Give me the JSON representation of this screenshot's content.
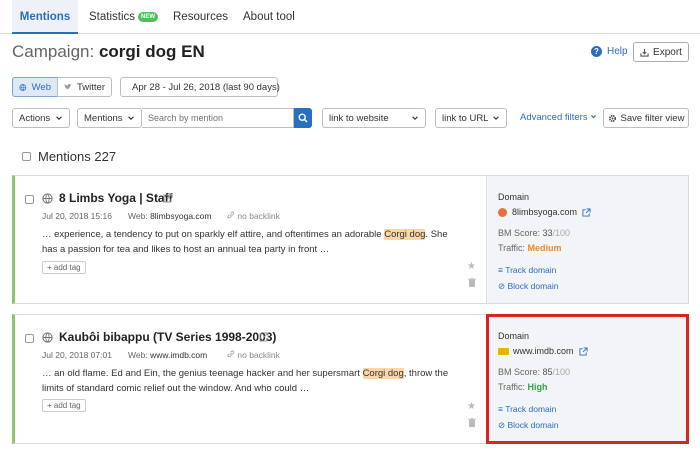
{
  "tabs": [
    {
      "label": "Mentions",
      "active": true
    },
    {
      "label": "Statistics",
      "badge": "NEW"
    },
    {
      "label": "Resources"
    },
    {
      "label": "About tool"
    }
  ],
  "header": {
    "campaign_label": "Campaign:",
    "campaign_name": "corgi dog EN",
    "help_label": "Help",
    "export_label": "Export"
  },
  "source_toggle": {
    "web_label": "Web",
    "twitter_label": "Twitter"
  },
  "date_range": "Apr 28 - Jul 26, 2018 (last 90 days)",
  "filters": {
    "actions_label": "Actions",
    "mentions_label": "Mentions",
    "search_placeholder": "Search by mention",
    "website_label": "link to website",
    "url_label": "link to URL",
    "advanced_label": "Advanced filters",
    "save_label": "Save filter view"
  },
  "mentions_count_label": "Mentions 227",
  "mentions": [
    {
      "title": "8 Limbs Yoga | Staff",
      "date": "Jul 20, 2018 15:16",
      "web_label": "Web:",
      "web": "8limbsyoga.com",
      "backlink": "no backlink",
      "snippet_a": "… experience, a tendency to put on sparkly elf attire, and oftentimes an adorable ",
      "snippet_hl": "Corgi dog",
      "snippet_b": ". She has a passion for tea and likes to host an annual tea party in front …",
      "add_tag": "+ add tag",
      "domain_label": "Domain",
      "domain": "8limbsyoga.com",
      "bm_label": "BM Score:",
      "bm_value": "33",
      "bm_max": "/100",
      "traffic_label": "Traffic:",
      "traffic": "Medium",
      "track": "Track domain",
      "block": "Block domain"
    },
    {
      "title": "Kaubôi bibappu (TV Series 1998-2003)",
      "date": "Jul 20, 2018 07:01",
      "web_label": "Web:",
      "web": "www.imdb.com",
      "backlink": "no backlink",
      "snippet_a": "… an old flame. Ed and Ein, the genius teenage hacker and her supersmart ",
      "snippet_hl": "Corgi dog",
      "snippet_b": ", throw the limits of standard comic relief out the window. And who could …",
      "add_tag": "+ add tag",
      "domain_label": "Domain",
      "domain": "www.imdb.com",
      "bm_label": "BM Score:",
      "bm_value": "85",
      "bm_max": "/100",
      "traffic_label": "Traffic:",
      "traffic": "High",
      "track": "Track domain",
      "block": "Block domain"
    }
  ],
  "colors": {
    "accent": "#2a6ebf",
    "card_border": "#8cc56d",
    "highlight_box": "#d8251f",
    "traffic_medium": "#f08a24",
    "traffic_high": "#34a34b",
    "keyword_highlight": "#fbd6a4"
  }
}
